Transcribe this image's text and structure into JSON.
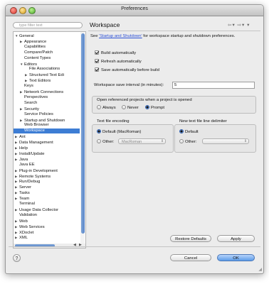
{
  "window": {
    "title": "Preferences"
  },
  "filter": {
    "placeholder": "type filter text"
  },
  "tree": {
    "items": [
      {
        "label": "General",
        "indent": 0,
        "expander": "down"
      },
      {
        "label": "Appearance",
        "indent": 1,
        "expander": "right"
      },
      {
        "label": "Capabilities",
        "indent": 1,
        "expander": ""
      },
      {
        "label": "Compare/Patch",
        "indent": 1,
        "expander": ""
      },
      {
        "label": "Content Types",
        "indent": 1,
        "expander": ""
      },
      {
        "label": "Editors",
        "indent": 1,
        "expander": "down"
      },
      {
        "label": "File Associations",
        "indent": 2,
        "expander": ""
      },
      {
        "label": "Structured Text Edi",
        "indent": 2,
        "expander": "right"
      },
      {
        "label": "Text Editors",
        "indent": 2,
        "expander": "right"
      },
      {
        "label": "Keys",
        "indent": 1,
        "expander": ""
      },
      {
        "label": "Network Connections",
        "indent": 1,
        "expander": "right"
      },
      {
        "label": "Perspectives",
        "indent": 1,
        "expander": ""
      },
      {
        "label": "Search",
        "indent": 1,
        "expander": ""
      },
      {
        "label": "Security",
        "indent": 1,
        "expander": "right"
      },
      {
        "label": "Service Policies",
        "indent": 1,
        "expander": ""
      },
      {
        "label": "Startup and Shutdown",
        "indent": 1,
        "expander": "right"
      },
      {
        "label": "Web Browser",
        "indent": 1,
        "expander": ""
      },
      {
        "label": "Workspace",
        "indent": 1,
        "expander": "",
        "selected": true
      },
      {
        "label": "Ant",
        "indent": 0,
        "expander": "right"
      },
      {
        "label": "Data Management",
        "indent": 0,
        "expander": "right"
      },
      {
        "label": "Help",
        "indent": 0,
        "expander": "right"
      },
      {
        "label": "Install/Update",
        "indent": 0,
        "expander": "right"
      },
      {
        "label": "Java",
        "indent": 0,
        "expander": "right"
      },
      {
        "label": "Java EE",
        "indent": 0,
        "expander": ""
      },
      {
        "label": "Plug-in Development",
        "indent": 0,
        "expander": "right"
      },
      {
        "label": "Remote Systems",
        "indent": 0,
        "expander": "right"
      },
      {
        "label": "Run/Debug",
        "indent": 0,
        "expander": "right"
      },
      {
        "label": "Server",
        "indent": 0,
        "expander": "right"
      },
      {
        "label": "Tasks",
        "indent": 0,
        "expander": "right"
      },
      {
        "label": "Team",
        "indent": 0,
        "expander": "right"
      },
      {
        "label": "Terminal",
        "indent": 0,
        "expander": ""
      },
      {
        "label": "Usage Data Collector",
        "indent": 0,
        "expander": "right"
      },
      {
        "label": "Validation",
        "indent": 0,
        "expander": ""
      },
      {
        "label": "Web",
        "indent": 0,
        "expander": "right"
      },
      {
        "label": "Web Services",
        "indent": 0,
        "expander": "right"
      },
      {
        "label": "XDoclet",
        "indent": 0,
        "expander": "right"
      },
      {
        "label": "XML",
        "indent": 0,
        "expander": "right"
      }
    ]
  },
  "page": {
    "heading": "Workspace",
    "description_pre": "See ",
    "description_link": "'Startup and Shutdown'",
    "description_post": " for workspace startup and shutdown preferences."
  },
  "options": {
    "build_automatically": {
      "label": "Build automatically",
      "checked": true
    },
    "refresh_automatically": {
      "label": "Refresh automatically",
      "checked": true
    },
    "save_before_build": {
      "label": "Save automatically before build",
      "checked": true
    }
  },
  "save_interval": {
    "label": "Workspace save interval (in minutes):",
    "value": "5"
  },
  "open_projects": {
    "label": "Open referenced projects when a project is opened",
    "choices": [
      "Always",
      "Never",
      "Prompt"
    ],
    "selected": "Prompt"
  },
  "encoding": {
    "label": "Text file encoding",
    "default_label": "Default (MacRoman)",
    "other_label": "Other:",
    "other_value": "MacRoman",
    "selected": "Default"
  },
  "line_delimiter": {
    "label": "New text file line delimiter",
    "default_label": "Default",
    "other_label": "Other:",
    "selected": "Default"
  },
  "buttons": {
    "restore_defaults": "Restore Defaults",
    "apply": "Apply",
    "cancel": "Cancel",
    "ok": "OK",
    "help": "?"
  },
  "icons": {
    "back": "back-arrow-icon",
    "forward": "forward-arrow-icon",
    "menu": "view-menu-icon"
  }
}
